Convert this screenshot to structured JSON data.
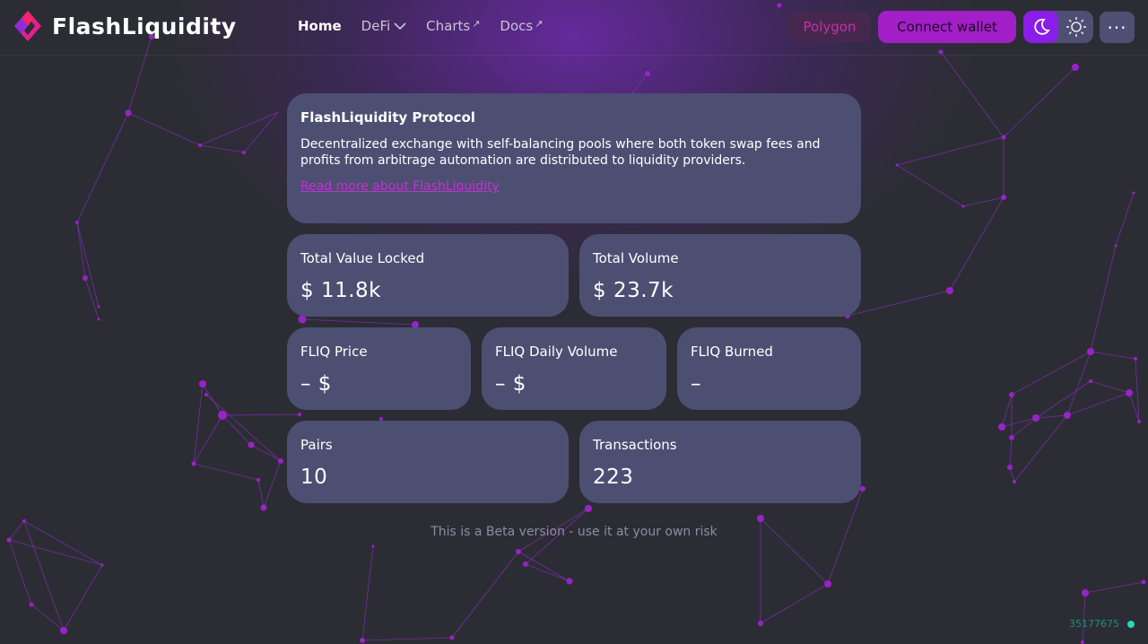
{
  "app": {
    "name": "FlashLiquidity"
  },
  "nav": {
    "home": "Home",
    "defi": "DeFi",
    "charts": "Charts",
    "docs": "Docs",
    "external_mark": "↗"
  },
  "header": {
    "network": "Polygon",
    "connect_wallet": "Connect wallet",
    "more": "···"
  },
  "intro": {
    "title": "FlashLiquidity Protocol",
    "description": "Decentralized exchange with self-balancing pools where both token swap fees and profits from arbitrage automation are distributed to liquidity providers.",
    "link": "Read more about FlashLiquidity"
  },
  "stats": {
    "tvl": {
      "label": "Total Value Locked",
      "value": "$ 11.8k"
    },
    "volume": {
      "label": "Total Volume",
      "value": "$ 23.7k"
    },
    "fliq_price": {
      "label": "FLIQ Price",
      "value": "– $"
    },
    "fliq_daily_volume": {
      "label": "FLIQ Daily Volume",
      "value": "– $"
    },
    "fliq_burned": {
      "label": "FLIQ Burned",
      "value": "–"
    },
    "pairs": {
      "label": "Pairs",
      "value": "10"
    },
    "transactions": {
      "label": "Transactions",
      "value": "223"
    }
  },
  "footer": {
    "beta_notice": "This is a Beta version - use it at your own risk",
    "block_number": "35177675"
  },
  "colors": {
    "background": "#2c2d34",
    "card": "#4d4f72",
    "accent": "#a21fc7",
    "link": "#c52fd4",
    "status_dot": "#22d9b9"
  },
  "icons": {
    "logo": "flashliquidity-logo-icon",
    "chevron": "chevron-down-icon",
    "moon": "moon-icon",
    "sun": "sun-icon",
    "status": "status-dot-icon"
  }
}
